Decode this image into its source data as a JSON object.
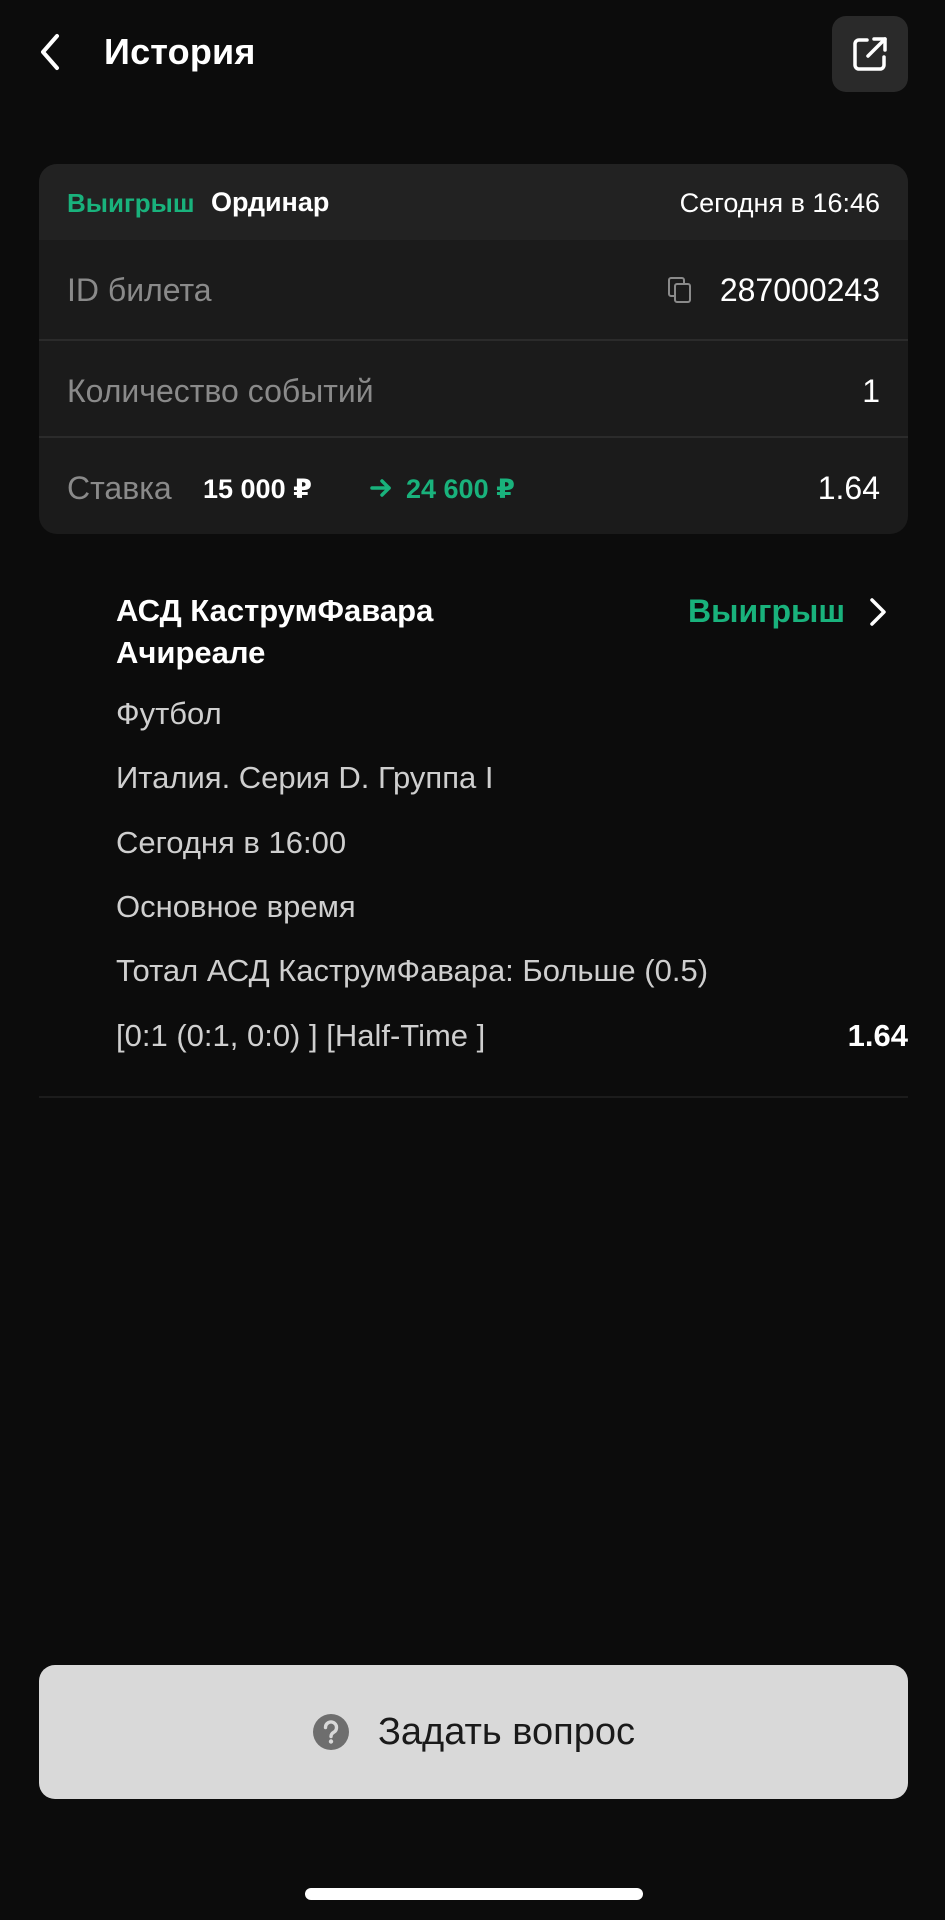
{
  "header": {
    "title": "История",
    "back_icon": "chevron-left-icon",
    "share_icon": "external-link-icon"
  },
  "ticket": {
    "status": "Выигрыш",
    "bet_type": "Ординар",
    "datetime": "Сегодня в 16:46",
    "rows": {
      "id_label": "ID билета",
      "id_value": "287000243",
      "count_label": "Количество событий",
      "count_value": "1",
      "stake_label": "Ставка",
      "stake_amount": "15 000 ₽",
      "win_amount": "24 600 ₽",
      "odds": "1.64"
    }
  },
  "event": {
    "title": "АСД КаструмФавара Ачиреале",
    "status": "Выигрыш",
    "sport": "Футбол",
    "league": "Италия. Серия D. Группа I",
    "start_time": "Сегодня в 16:00",
    "period": "Основное время",
    "market": "Тотал АСД КаструмФавара: Больше (0.5)",
    "score": "[0:1 (0:1, 0:0) ] [Half-Time ]",
    "odds": "1.64"
  },
  "footer": {
    "ask_label": "Задать вопрос",
    "ask_icon": "question-circle-icon"
  },
  "colors": {
    "background": "#0c0c0c",
    "card": "#1b1b1b",
    "accent_green": "#19b27c",
    "button": "#d9d9d9"
  }
}
